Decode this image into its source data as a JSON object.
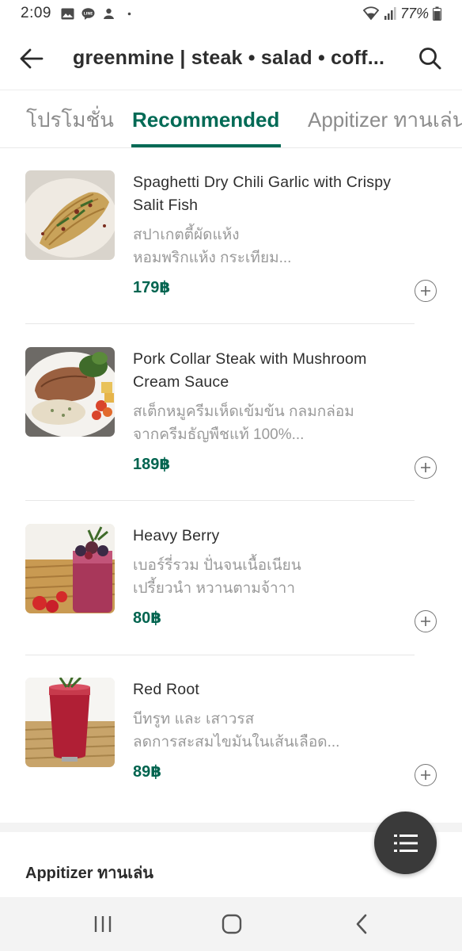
{
  "status_bar": {
    "time": "2:09",
    "battery": "77%",
    "icons": [
      "gallery-icon",
      "line-icon",
      "app-icon",
      "dot-icon",
      "wifi-icon",
      "signal-icon",
      "battery-icon"
    ]
  },
  "header": {
    "title": "greenmine | steak • salad • coff..."
  },
  "tabs": [
    {
      "label": "โปรโมชั่น",
      "active": false
    },
    {
      "label": "Recommended",
      "active": true
    },
    {
      "label": "Appitizer ทานเล่น",
      "active": false
    }
  ],
  "menu_items": [
    {
      "name": "Spaghetti Dry Chili Garlic with Crispy Salit Fish",
      "desc_line1": "สปาเกตตี้ผัดแห้ง",
      "desc_line2": "หอมพริกแห้ง กระเทียม...",
      "price": "179฿",
      "image": "spaghetti-photo"
    },
    {
      "name": "Pork Collar Steak with Mushroom Cream Sauce",
      "desc_line1": "สเต็กหมูครีมเห็ดเข้มข้น กลมกล่อม",
      "desc_line2": "จากครีมธัญพืชแท้ 100%...",
      "price": "189฿",
      "image": "steak-photo"
    },
    {
      "name": "Heavy Berry",
      "desc_line1": "เบอร์รี่รวม ปั่นจนเนื้อเนียน",
      "desc_line2": "เปรี้ยวนำ หวานตามจ้าาา",
      "price": "80฿",
      "image": "berry-smoothie-photo"
    },
    {
      "name": "Red Root",
      "desc_line1": "บีทรูท และ เสาวรส",
      "desc_line2": "ลดการสะสมไขมันในเส้นเลือด...",
      "price": "89฿",
      "image": "red-root-drink-photo"
    }
  ],
  "next_section": {
    "title": "Appitizer ทานเล่น"
  },
  "colors": {
    "accent": "#006a55",
    "price": "#00644f",
    "fab": "#3a3a3a"
  }
}
